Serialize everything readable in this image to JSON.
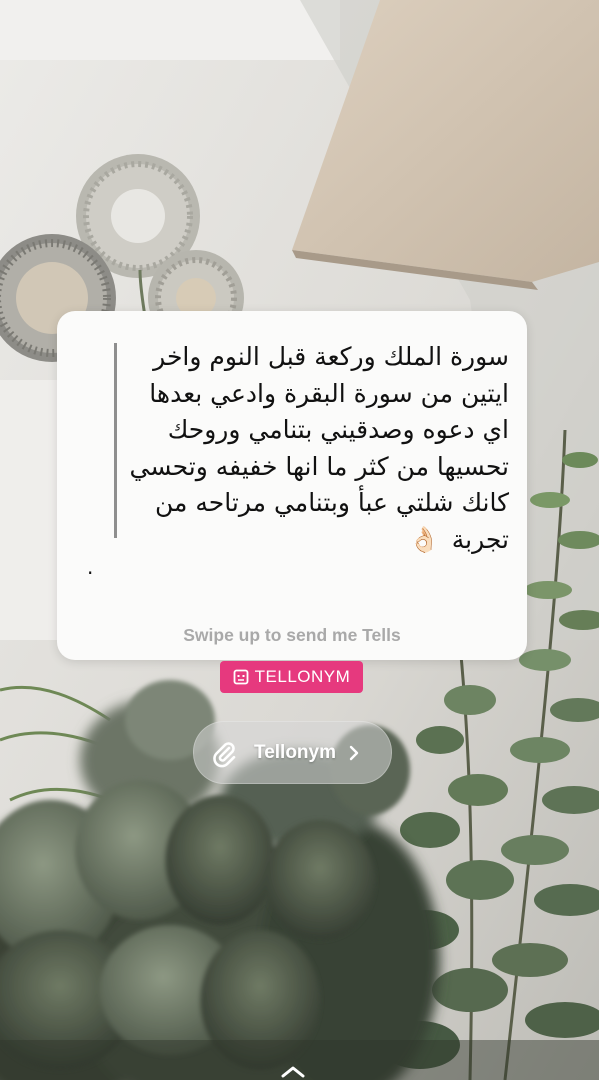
{
  "story": {
    "card": {
      "message": "سورة الملك وركعة قبل النوم واخر\nايتين من سورة البقرة وادعي بعدها\nاي دعوه وصدقيني بتنامي وروحك\nتحسيها من كثر ما انها خفيفه وتحسي\nكانك شلتي عبأ وبتنامي مرتاحه من\nتجربة",
      "emoji": "👌🏻",
      "dot": ".",
      "hint": "Swipe up to send me Tells"
    },
    "brand_badge": {
      "label": "TELLONYM",
      "icon": "tellonym-box-icon",
      "color": "#e6397e"
    },
    "link_sticker": {
      "label": "Tellonym",
      "icon": "paperclip-icon",
      "chevron": "chevron-right-icon"
    },
    "swipe_up_icon": "chevron-up-icon"
  }
}
